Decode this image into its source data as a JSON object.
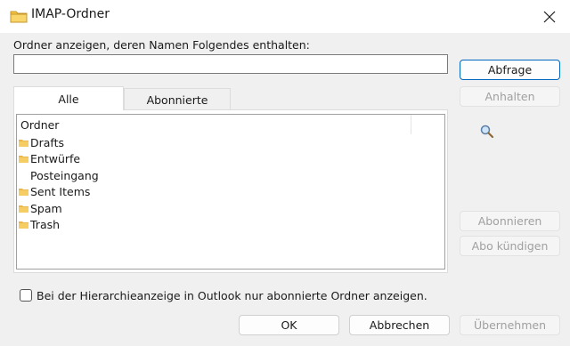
{
  "window": {
    "title": "IMAP-Ordner"
  },
  "filter": {
    "label": "Ordner anzeigen, deren Namen Folgendes enthalten:",
    "value": "",
    "placeholder": ""
  },
  "tabs": [
    {
      "label": "Alle"
    },
    {
      "label": "Abonnierte"
    }
  ],
  "tree": {
    "header": "Ordner",
    "items": [
      {
        "label": "Drafts",
        "icon": "folder-icon"
      },
      {
        "label": "Entwürfe",
        "icon": "folder-icon"
      },
      {
        "label": "Posteingang",
        "icon": ""
      },
      {
        "label": "Sent Items",
        "icon": "folder-icon"
      },
      {
        "label": "Spam",
        "icon": "folder-icon"
      },
      {
        "label": "Trash",
        "icon": "folder-icon"
      }
    ]
  },
  "side_buttons": {
    "query": "Abfrage",
    "stop": "Anhalten",
    "subscribe": "Abonnieren",
    "unsubscribe": "Abo kündigen"
  },
  "checkbox": {
    "label": "Bei der Hierarchieanzeige in Outlook nur abonnierte Ordner anzeigen.",
    "checked": false
  },
  "footer": {
    "ok": "OK",
    "cancel": "Abbrechen",
    "apply": "Übernehmen"
  },
  "colors": {
    "accent": "#0067c0",
    "folder": "#e8b84a",
    "dialog_bg": "#f0f0f0"
  }
}
